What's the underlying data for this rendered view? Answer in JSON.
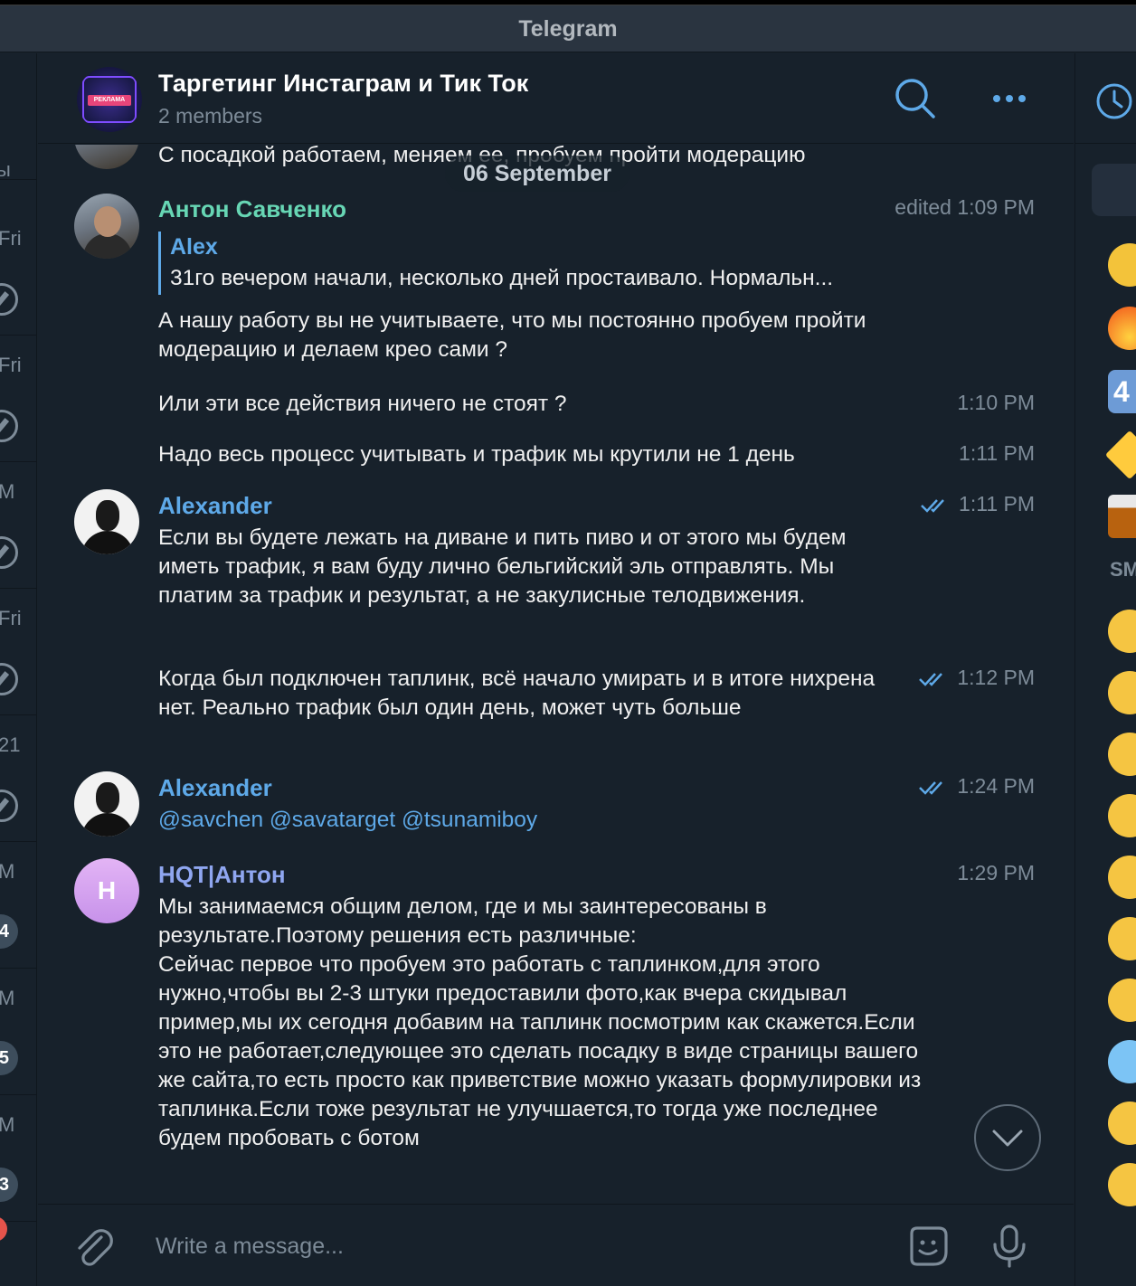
{
  "window": {
    "title": "Telegram"
  },
  "left_list": {
    "items": [
      {
        "label": "ы",
        "pin": false
      },
      {
        "label": "Fri",
        "pin": true
      },
      {
        "label": "Fri",
        "pin": true
      },
      {
        "label": "M",
        "pin": true
      },
      {
        "label": "Fri",
        "pin": true
      },
      {
        "label": "21",
        "pin": true
      },
      {
        "label": "M",
        "badge": "4"
      },
      {
        "label": "M",
        "badge": "5"
      },
      {
        "label": "M",
        "badge": "3"
      }
    ]
  },
  "header": {
    "title": "Таргетинг Инстаграм и Тик Ток",
    "subtitle": "2 members",
    "avatar_text": "РЕКЛАМА"
  },
  "date_separator": "06 September",
  "partial_message": "С посадкой работаем, меняем ее, пробуем пройти модерацию",
  "messages": [
    {
      "author": "Антон Савченко",
      "time": "edited  1:09 PM",
      "reply": {
        "name": "Alex",
        "text": "31го вечером начали, несколько дней простаивало. Нормальн..."
      },
      "text": "А нашу работу вы не учитываете, что мы постоянно пробуем пройти модерацию и делаем крео сами ?"
    },
    {
      "text": "Или эти все действия ничего не стоят ?",
      "time": "1:10 PM"
    },
    {
      "text": "Надо весь процесс учитывать и трафик мы крутили не 1 день",
      "time": "1:11 PM"
    },
    {
      "author": "Alexander",
      "time": "1:11 PM",
      "text": "Если вы будете лежать на диване и пить пиво и от этого мы будем иметь трафик, я вам буду лично бельгийский эль отправлять. Мы платим за трафик и результат, а не закулисные телодвижения."
    },
    {
      "text": "Когда был подключен таплинк, всё начало умирать и в итоге нихрена нет. Реально трафик был один день, может чуть больше",
      "time": "1:12 PM"
    },
    {
      "author": "Alexander",
      "time": "1:24 PM",
      "mentions": "@savchen @savatarget @tsunamiboy"
    },
    {
      "author": "HQT|Антон",
      "avatar_letter": "H",
      "time": "1:29 PM",
      "text": "Мы занимаемся общим делом, где и мы заинтересованы в результате.Поэтому решения есть различные:\nСейчас первое что пробуем это работать с таплинком,для этого нужно,чтобы вы 2-3 штуки предоставили фото,как вчера скидывал пример,мы их сегодня добавим на таплинк посмотрим как скажется.Если это не работает,следующее это сделать посадку в виде страницы вашего же сайта,то есть просто как приветствие можно указать формулировки из таплинка.Если тоже результат не улучшается,то тогда уже последнее будем пробовать с ботом"
    }
  ],
  "right_panel": {
    "section_label": "SM",
    "emojis": [
      "thumbs-up",
      "fire",
      "keycap-4",
      "star",
      "whisky",
      "grinning",
      "sad-sweat",
      "heart-eyes",
      "tongue-wink",
      "star-struck",
      "confused",
      "crying",
      "cold-face",
      "hand-over-mouth",
      "laughing"
    ]
  },
  "composer": {
    "placeholder": "Write a message..."
  },
  "colors": {
    "background": "#17212b",
    "accent": "#5ea9e8",
    "name_anton": "#67d6b4",
    "name_hqt": "#8fa6f0"
  }
}
